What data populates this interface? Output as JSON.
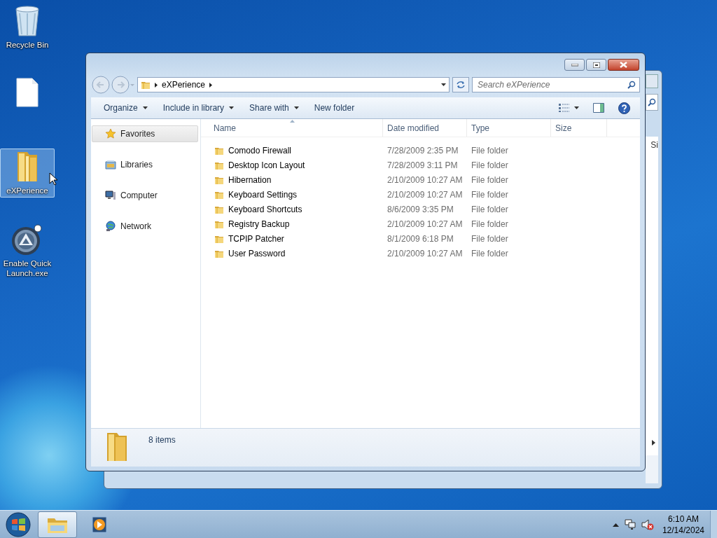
{
  "desktop_icons": [
    {
      "kind": "recycle-bin",
      "label": "Recycle Bin",
      "selected": false
    },
    {
      "kind": "file",
      "selected": false
    },
    {
      "kind": "folder",
      "label": "eXPerience",
      "selected": true
    },
    {
      "kind": "app",
      "label": "Enable Quick Launch.exe",
      "selected": false
    }
  ],
  "background_window": {
    "column_text": "Si"
  },
  "explorer": {
    "breadcrumb": [
      "eXPerience"
    ],
    "search": {
      "placeholder": "Search eXPerience"
    },
    "toolbar": [
      {
        "label": "Organize",
        "has_menu": true
      },
      {
        "label": "Include in library",
        "has_menu": true
      },
      {
        "label": "Share with",
        "has_menu": true
      },
      {
        "label": "New folder",
        "has_menu": false
      }
    ],
    "nav_items": [
      {
        "kind": "favorites",
        "label": "Favorites",
        "selected": true
      },
      {
        "kind": "libraries",
        "label": "Libraries",
        "selected": false
      },
      {
        "kind": "computer",
        "label": "Computer",
        "selected": false
      },
      {
        "kind": "network",
        "label": "Network",
        "selected": false
      }
    ],
    "columns": [
      {
        "label": "Name",
        "sorted": true
      },
      {
        "label": "Date modified",
        "sorted": false
      },
      {
        "label": "Type",
        "sorted": false
      },
      {
        "label": "Size",
        "sorted": false
      }
    ],
    "rows": [
      {
        "name": "Comodo Firewall",
        "date": "7/28/2009 2:35 PM",
        "type": "File folder"
      },
      {
        "name": "Desktop Icon Layout",
        "date": "7/28/2009 3:11 PM",
        "type": "File folder"
      },
      {
        "name": "Hibernation",
        "date": "2/10/2009 10:27 AM",
        "type": "File folder"
      },
      {
        "name": "Keyboard Settings",
        "date": "2/10/2009 10:27 AM",
        "type": "File folder"
      },
      {
        "name": "Keyboard Shortcuts",
        "date": "8/6/2009 3:35 PM",
        "type": "File folder"
      },
      {
        "name": "Registry Backup",
        "date": "2/10/2009 10:27 AM",
        "type": "File folder"
      },
      {
        "name": "TCPIP Patcher",
        "date": "8/1/2009 6:18 PM",
        "type": "File folder"
      },
      {
        "name": "User Password",
        "date": "2/10/2009 10:27 AM",
        "type": "File folder"
      }
    ],
    "status": "8 items"
  },
  "taskbar": {
    "items": [
      {
        "kind": "explorer",
        "selected": true
      },
      {
        "kind": "media",
        "selected": false
      }
    ],
    "time": "6:10 AM",
    "date": "12/14/2024"
  }
}
